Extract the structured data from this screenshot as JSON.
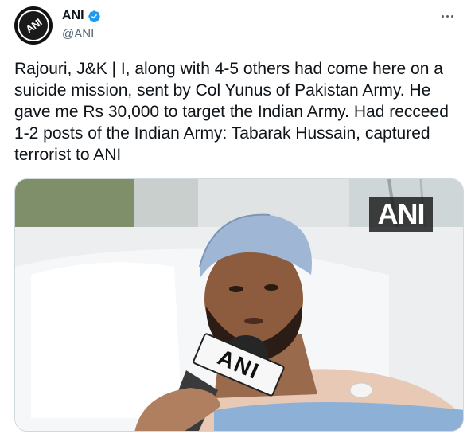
{
  "author": {
    "name": "ANI",
    "handle": "@ANI",
    "verified": true,
    "avatar_text": "ANI"
  },
  "tweet": {
    "text": "Rajouri, J&K | I, along with 4-5 others had come here on a suicide mission, sent by Col Yunus of Pakistan Army. He gave me Rs 30,000 to target the Indian Army. Had recceed 1-2 posts of the Indian Army: Tabarak Hussain, captured terrorist to ANI"
  },
  "media": {
    "watermark_text": "ANI",
    "mic_label_text": "ANI"
  },
  "colors": {
    "verified_blue": "#1d9bf0",
    "handle_gray": "#536471",
    "text_dark": "#0f1419"
  },
  "icons": {
    "verified": "verified-badge-icon",
    "more": "more-options-icon"
  }
}
